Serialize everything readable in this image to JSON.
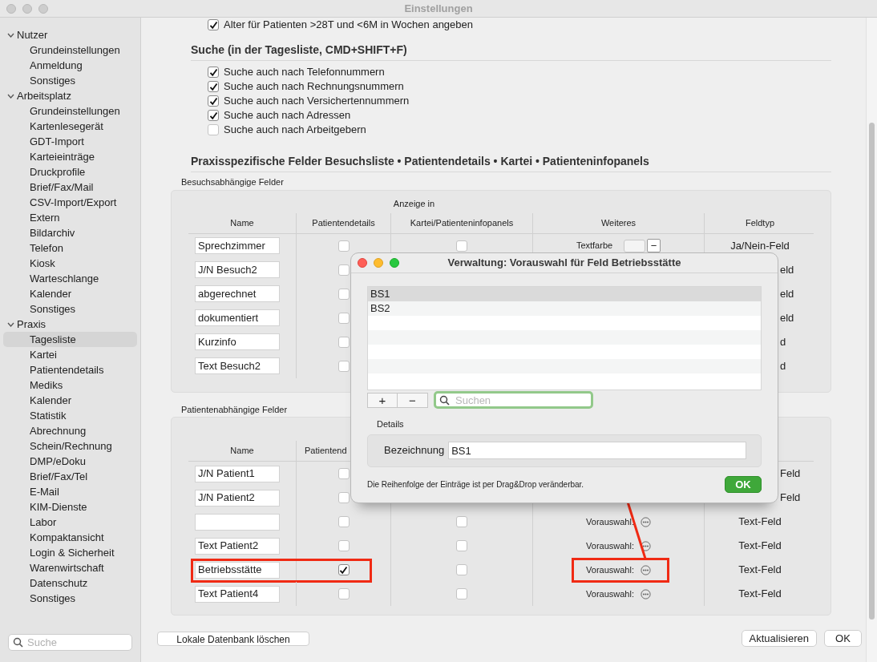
{
  "window": {
    "title": "Einstellungen"
  },
  "sidebar": {
    "sections": [
      {
        "label": "Nutzer",
        "expanded": true,
        "children": [
          {
            "label": "Grundeinstellungen",
            "selected": false
          },
          {
            "label": "Anmeldung",
            "selected": false
          },
          {
            "label": "Sonstiges",
            "selected": false
          }
        ]
      },
      {
        "label": "Arbeitsplatz",
        "expanded": true,
        "children": [
          {
            "label": "Grundeinstellungen",
            "selected": false
          },
          {
            "label": "Kartenlesegerät",
            "selected": false
          },
          {
            "label": "GDT-Import",
            "selected": false
          },
          {
            "label": "Karteieinträge",
            "selected": false
          },
          {
            "label": "Druckprofile",
            "selected": false
          },
          {
            "label": "Brief/Fax/Mail",
            "selected": false
          },
          {
            "label": "CSV-Import/Export",
            "selected": false
          },
          {
            "label": "Extern",
            "selected": false
          },
          {
            "label": "Bildarchiv",
            "selected": false
          },
          {
            "label": "Telefon",
            "selected": false
          },
          {
            "label": "Kiosk",
            "selected": false
          },
          {
            "label": "Warteschlange",
            "selected": false
          },
          {
            "label": "Kalender",
            "selected": false
          },
          {
            "label": "Sonstiges",
            "selected": false
          }
        ]
      },
      {
        "label": "Praxis",
        "expanded": true,
        "children": [
          {
            "label": "Tagesliste",
            "selected": true
          },
          {
            "label": "Kartei",
            "selected": false
          },
          {
            "label": "Patientendetails",
            "selected": false
          },
          {
            "label": "Mediks",
            "selected": false
          },
          {
            "label": "Kalender",
            "selected": false
          },
          {
            "label": "Statistik",
            "selected": false
          },
          {
            "label": "Abrechnung",
            "selected": false
          },
          {
            "label": "Schein/Rechnung",
            "selected": false
          },
          {
            "label": "DMP/eDoku",
            "selected": false
          },
          {
            "label": "Brief/Fax/Tel",
            "selected": false
          },
          {
            "label": "E-Mail",
            "selected": false
          },
          {
            "label": "KIM-Dienste",
            "selected": false
          },
          {
            "label": "Labor",
            "selected": false
          },
          {
            "label": "Kompaktansicht",
            "selected": false
          },
          {
            "label": "Login & Sicherheit",
            "selected": false
          },
          {
            "label": "Warenwirtschaft",
            "selected": false
          },
          {
            "label": "Datenschutz",
            "selected": false
          },
          {
            "label": "Sonstiges",
            "selected": false
          }
        ]
      }
    ],
    "search": {
      "placeholder": "Suche"
    }
  },
  "partial_option": {
    "label": "Alter für Patienten >28T und <6M in Wochen angeben",
    "checked": true
  },
  "search_section": {
    "title": "Suche (in der Tagesliste, CMD+SHIFT+F)",
    "options": [
      {
        "label": "Suche auch nach Telefonnummern",
        "checked": true
      },
      {
        "label": "Suche auch nach Rechnungsnummern",
        "checked": true
      },
      {
        "label": "Suche auch nach Versichertennummern",
        "checked": true
      },
      {
        "label": "Suche auch nach Adressen",
        "checked": true
      },
      {
        "label": "Suche auch nach Arbeitgebern",
        "checked": false
      }
    ]
  },
  "fields_section": {
    "title": "Praxisspezifische Felder Besuchsliste • Patientendetails • Kartei • Patienteninfopanels"
  },
  "visit_fields": {
    "title": "Besuchsabhängige Felder",
    "group_header": "Anzeige in",
    "columns": [
      {
        "label": "Name"
      },
      {
        "label": "Patientendetails"
      },
      {
        "label": "Kartei/Patienteninfopanels"
      },
      {
        "label": "Weiteres"
      },
      {
        "label": "Feldtyp"
      }
    ],
    "rows": [
      {
        "name": "Sprechzimmer",
        "details": false,
        "kartei": false,
        "extra": {
          "kind": "color",
          "label": "Textfarbe",
          "button": "−"
        },
        "type": "Ja/Nein-Feld",
        "partly_hidden": false
      },
      {
        "name": "J/N Besuch2",
        "details": false,
        "type": "eld",
        "partly_hidden": true
      },
      {
        "name": "abgerechnet",
        "details": false,
        "type": "eld",
        "partly_hidden": true
      },
      {
        "name": "dokumentiert",
        "details": false,
        "type": "eld",
        "partly_hidden": true
      },
      {
        "name": "Kurzinfo",
        "details": false,
        "type": "d",
        "partly_hidden": true
      },
      {
        "name": "Text Besuch2",
        "details": false,
        "type": "d",
        "partly_hidden": true
      }
    ]
  },
  "patient_fields": {
    "title": "Patientenabhängige Felder",
    "columns": [
      {
        "label": "Name",
        "partly_hidden": false
      },
      {
        "label": "Patientend",
        "partly_hidden": true
      }
    ],
    "rows": [
      {
        "name": "J/N Patient1",
        "details": false,
        "type": "Feld",
        "partly_hidden": true,
        "highlighted": false
      },
      {
        "name": "J/N Patient2",
        "details": false,
        "type": "Feld",
        "partly_hidden": true,
        "highlighted": false
      },
      {
        "details": false,
        "kartei": false,
        "extra": {
          "kind": "preselect",
          "label": "Vorauswahl:"
        },
        "type": "Text-Feld",
        "partly_hidden": false,
        "highlighted": false
      },
      {
        "name": "Text Patient2",
        "details": false,
        "kartei": false,
        "extra": {
          "kind": "preselect",
          "label": "Vorauswahl:"
        },
        "type": "Text-Feld",
        "partly_hidden": false,
        "highlighted": false
      },
      {
        "name": "Betriebsstätte",
        "details": true,
        "kartei": false,
        "extra": {
          "kind": "preselect",
          "label": "Vorauswahl:"
        },
        "type": "Text-Feld",
        "partly_hidden": false,
        "highlighted": true
      },
      {
        "name": "Text Patient4",
        "details": false,
        "kartei": false,
        "extra": {
          "kind": "preselect",
          "label": "Vorauswahl:"
        },
        "type": "Text-Feld",
        "partly_hidden": false,
        "highlighted": false
      }
    ]
  },
  "footer": {
    "delete_button": "Lokale Datenbank löschen",
    "refresh_button": "Aktualisieren",
    "ok_button": "OK"
  },
  "dialog": {
    "title": "Verwaltung: Vorauswahl für Feld Betriebsstätte",
    "items": [
      {
        "label": "BS1",
        "selected": true
      },
      {
        "label": "BS2",
        "selected": false
      }
    ],
    "add_button": "+",
    "remove_button": "−",
    "search": {
      "placeholder": "Suchen"
    },
    "details_title": "Details",
    "field": {
      "label": "Bezeichnung",
      "value": "BS1"
    },
    "hint": "Die Reihenfolge der Einträge ist per Drag&Drop veränderbar.",
    "ok_button": "OK"
  }
}
